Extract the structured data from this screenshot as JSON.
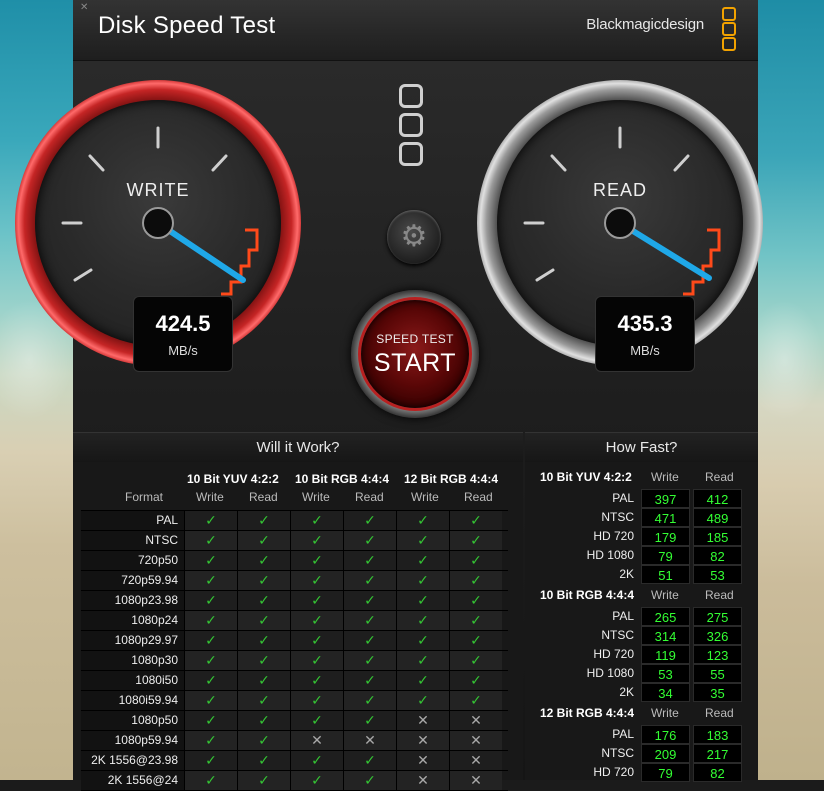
{
  "window": {
    "title": "Disk Speed Test",
    "brand": "Blackmagicdesign",
    "close_glyph": "✕"
  },
  "gauges": {
    "write": {
      "label": "WRITE",
      "value": "424.5",
      "unit": "MB/s"
    },
    "read": {
      "label": "READ",
      "value": "435.3",
      "unit": "MB/s"
    }
  },
  "start_button": {
    "small": "SPEED TEST",
    "big": "START"
  },
  "settings_button": {
    "icon": "gear-icon"
  },
  "will_it_work": {
    "title": "Will it Work?",
    "format_label": "Format",
    "groups": [
      "10 Bit YUV 4:2:2",
      "10 Bit RGB 4:4:4",
      "12 Bit RGB 4:4:4"
    ],
    "sub_headers": [
      "Write",
      "Read",
      "Write",
      "Read",
      "Write",
      "Read"
    ],
    "rows": [
      {
        "format": "PAL",
        "cells": [
          "ok",
          "ok",
          "ok",
          "ok",
          "ok",
          "ok"
        ]
      },
      {
        "format": "NTSC",
        "cells": [
          "ok",
          "ok",
          "ok",
          "ok",
          "ok",
          "ok"
        ]
      },
      {
        "format": "720p50",
        "cells": [
          "ok",
          "ok",
          "ok",
          "ok",
          "ok",
          "ok"
        ]
      },
      {
        "format": "720p59.94",
        "cells": [
          "ok",
          "ok",
          "ok",
          "ok",
          "ok",
          "ok"
        ]
      },
      {
        "format": "1080p23.98",
        "cells": [
          "ok",
          "ok",
          "ok",
          "ok",
          "ok",
          "ok"
        ]
      },
      {
        "format": "1080p24",
        "cells": [
          "ok",
          "ok",
          "ok",
          "ok",
          "ok",
          "ok"
        ]
      },
      {
        "format": "1080p29.97",
        "cells": [
          "ok",
          "ok",
          "ok",
          "ok",
          "ok",
          "ok"
        ]
      },
      {
        "format": "1080p30",
        "cells": [
          "ok",
          "ok",
          "ok",
          "ok",
          "ok",
          "ok"
        ]
      },
      {
        "format": "1080i50",
        "cells": [
          "ok",
          "ok",
          "ok",
          "ok",
          "ok",
          "ok"
        ]
      },
      {
        "format": "1080i59.94",
        "cells": [
          "ok",
          "ok",
          "ok",
          "ok",
          "ok",
          "ok"
        ]
      },
      {
        "format": "1080p50",
        "cells": [
          "ok",
          "ok",
          "ok",
          "ok",
          "no",
          "no"
        ]
      },
      {
        "format": "1080p59.94",
        "cells": [
          "ok",
          "ok",
          "no",
          "no",
          "no",
          "no"
        ]
      },
      {
        "format": "2K 1556@23.98",
        "cells": [
          "ok",
          "ok",
          "ok",
          "ok",
          "no",
          "no"
        ]
      },
      {
        "format": "2K 1556@24",
        "cells": [
          "ok",
          "ok",
          "ok",
          "ok",
          "no",
          "no"
        ]
      }
    ]
  },
  "how_fast": {
    "title": "How Fast?",
    "groups": [
      {
        "name": "10 Bit YUV 4:2:2",
        "write_label": "Write",
        "read_label": "Read",
        "rows": [
          {
            "label": "PAL",
            "write": "397",
            "read": "412"
          },
          {
            "label": "NTSC",
            "write": "471",
            "read": "489"
          },
          {
            "label": "HD 720",
            "write": "179",
            "read": "185"
          },
          {
            "label": "HD 1080",
            "write": "79",
            "read": "82"
          },
          {
            "label": "2K",
            "write": "51",
            "read": "53"
          }
        ]
      },
      {
        "name": "10 Bit RGB 4:4:4",
        "write_label": "Write",
        "read_label": "Read",
        "rows": [
          {
            "label": "PAL",
            "write": "265",
            "read": "275"
          },
          {
            "label": "NTSC",
            "write": "314",
            "read": "326"
          },
          {
            "label": "HD 720",
            "write": "119",
            "read": "123"
          },
          {
            "label": "HD 1080",
            "write": "53",
            "read": "55"
          },
          {
            "label": "2K",
            "write": "34",
            "read": "35"
          }
        ]
      },
      {
        "name": "12 Bit RGB 4:4:4",
        "write_label": "Write",
        "read_label": "Read",
        "rows": [
          {
            "label": "PAL",
            "write": "176",
            "read": "183"
          },
          {
            "label": "NTSC",
            "write": "209",
            "read": "217"
          },
          {
            "label": "HD 720",
            "write": "79",
            "read": "82"
          }
        ]
      }
    ]
  },
  "colors": {
    "accent_orange": "#f2a200",
    "write_ring": "#c52525",
    "needle": "#1fa8e8",
    "check_green": "#34c534",
    "value_green": "#33ff33"
  }
}
